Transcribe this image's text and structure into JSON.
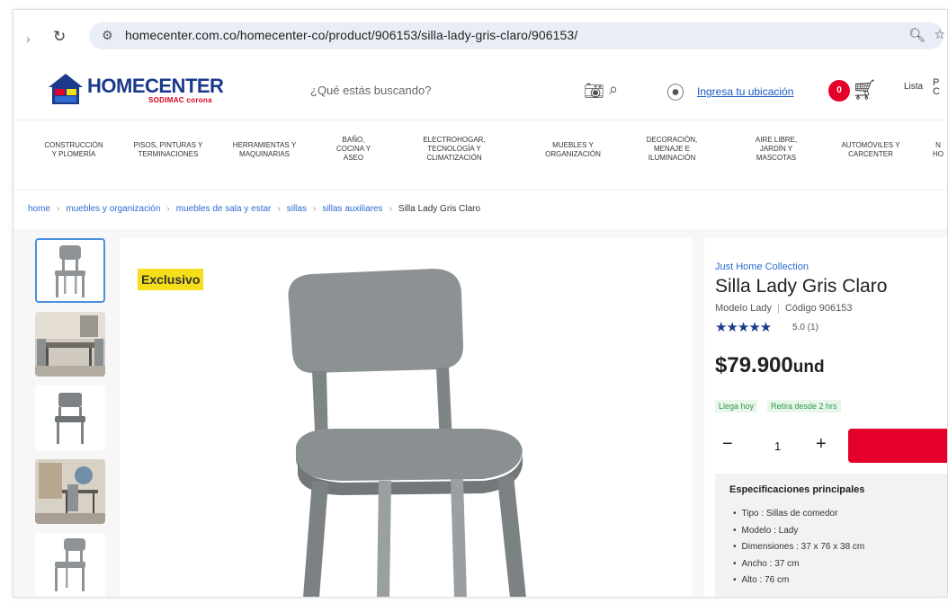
{
  "browser": {
    "url": "homecenter.com.co/homecenter-co/product/906153/silla-lady-gris-claro/906153/"
  },
  "header": {
    "logo_text": "HOMECENTER",
    "logo_sub": "SODIMAC corona",
    "search_placeholder": "¿Qué estás buscando?",
    "location_link": "Ingresa tu ubicación",
    "cart_count": "0",
    "lists_icon_text": "Lista",
    "lists_text": "P\nC"
  },
  "categories": [
    "CONSTRUCCIÓN\nY PLOMERÍA",
    "PISOS, PINTURAS Y\nTERMINACIONES",
    "HERRAMIENTAS Y\nMAQUINARIAS",
    "BAÑO,\nCOCINA Y\nASEO",
    "ELECTROHOGAR,\nTECNOLOGÍA Y\nCLIMATIZACIÓN",
    "MUEBLES Y\nORGANIZACIÓN",
    "DECORACIÓN,\nMENAJE E\nILUMINACIÓN",
    "AIRE LIBRE,\nJARDÍN Y\nMASCOTAS",
    "AUTOMÓVILES Y\nCARCENTER",
    "N\nHO"
  ],
  "breadcrumb": {
    "items": [
      "home",
      "muebles y organización",
      "muebles de sala y estar",
      "sillas",
      "sillas auxiliares"
    ],
    "current": "Silla Lady Gris Claro"
  },
  "gallery": {
    "badge": "Exclusivo"
  },
  "product": {
    "brand": "Just Home Collection",
    "title": "Silla Lady Gris Claro",
    "model": "Modelo Lady",
    "code": "Código 906153",
    "stars": "★★★★★",
    "rating": "5.0 (1)",
    "price": "$79.900",
    "price_unit": "und",
    "tag_delivery": "Llega hoy",
    "tag_pickup": "Retira desde 2 hrs",
    "quantity": "1",
    "specs_title": "Especificaciones principales",
    "specs": [
      "Tipo : Sillas de comedor",
      "Modelo : Lady",
      "Dimensiones : 37 x 76 x 38 cm",
      "Ancho : 37 cm",
      "Alto : 76 cm"
    ]
  },
  "colors": {
    "brand_blue": "#1b3a8c",
    "accent_red": "#e4002b",
    "link_blue": "#2c6bd1",
    "badge_yellow": "#f5df1b"
  }
}
